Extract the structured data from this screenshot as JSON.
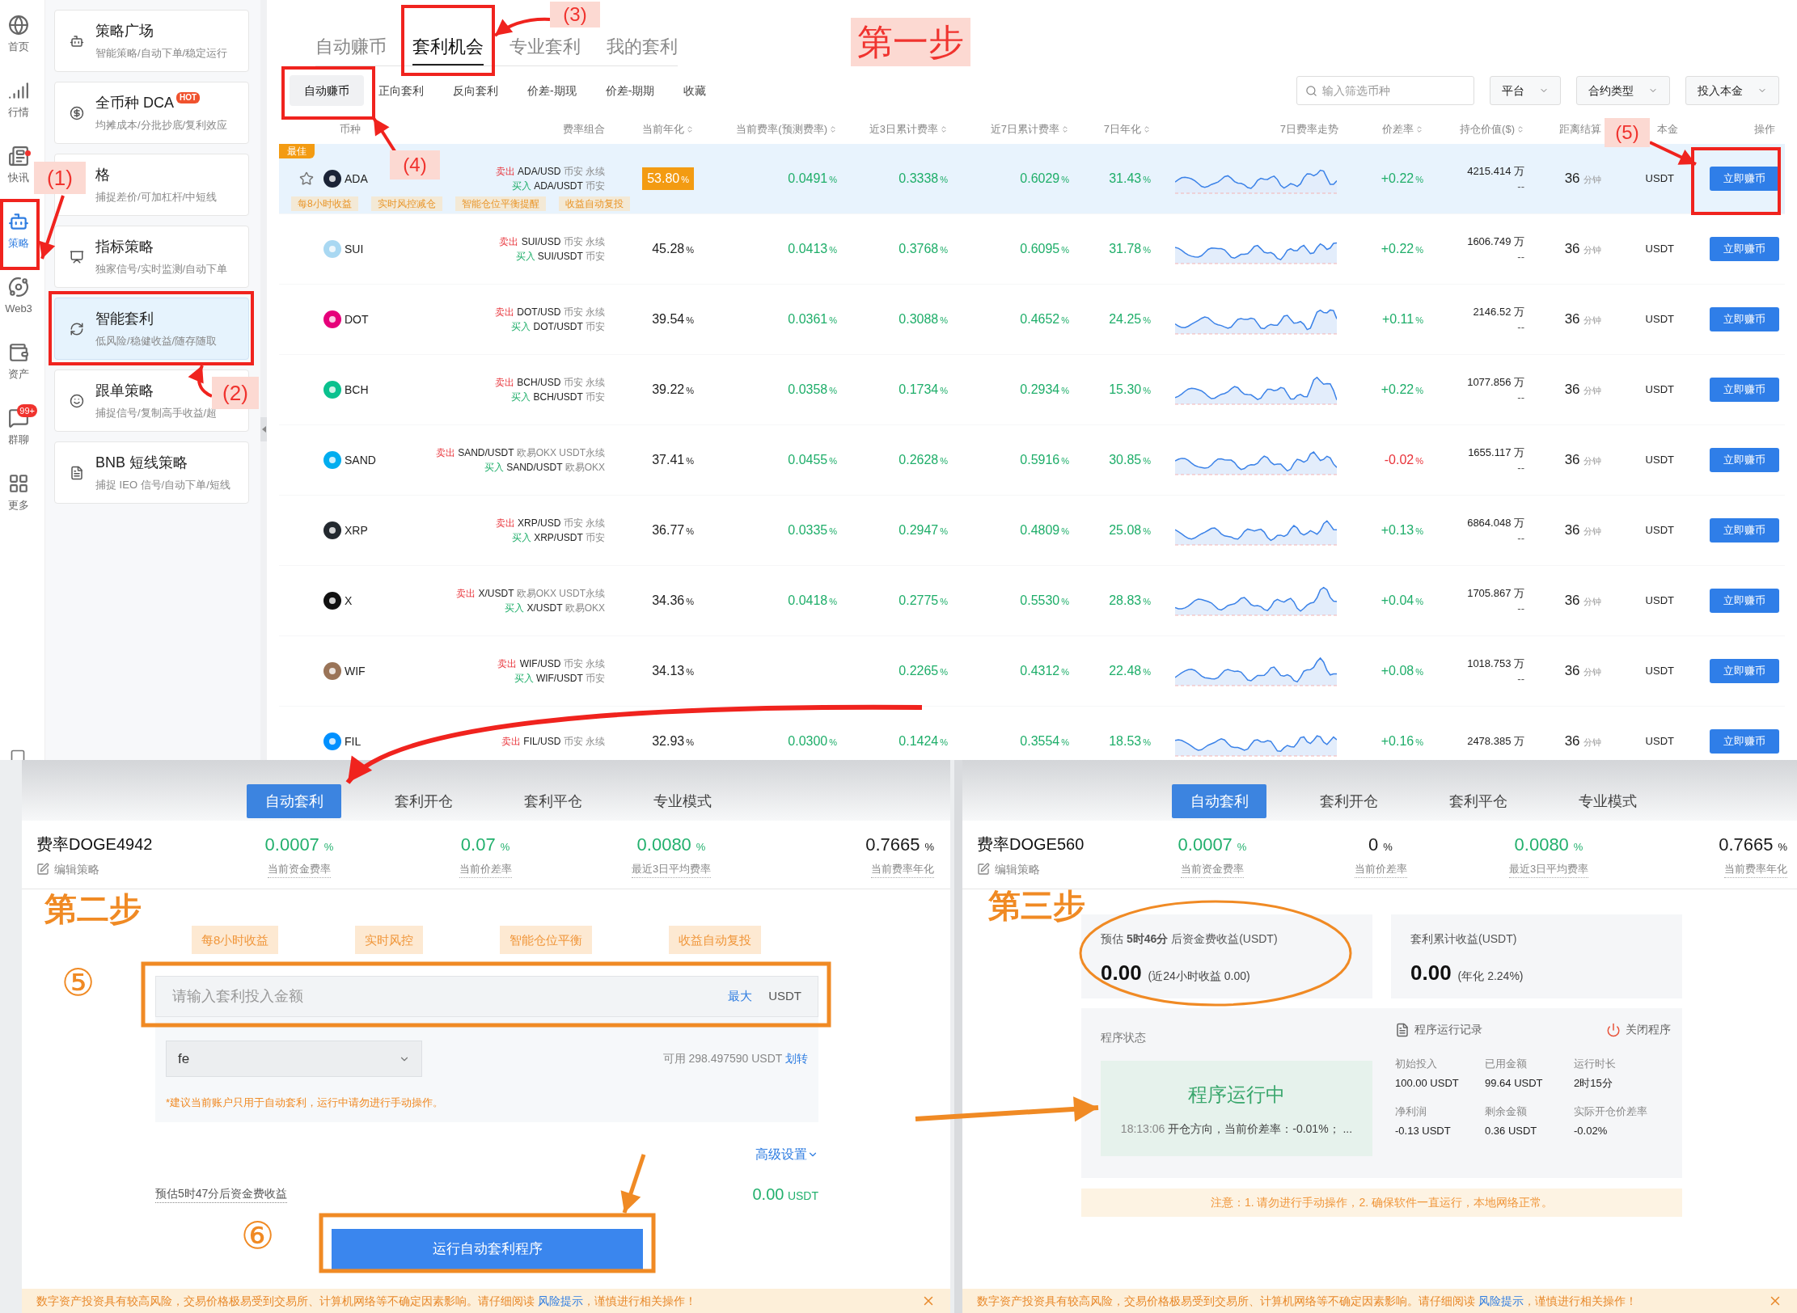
{
  "rail": [
    {
      "label": "首页",
      "selected": false,
      "dot": false
    },
    {
      "label": "行情",
      "selected": false,
      "dot": false
    },
    {
      "label": "快讯",
      "selected": false,
      "dot": true
    },
    {
      "label": "策略",
      "selected": true,
      "dot": false
    },
    {
      "label": "Web3",
      "selected": false,
      "dot": false
    },
    {
      "label": "资产",
      "selected": false,
      "dot": false
    },
    {
      "label": "群聊",
      "selected": false,
      "dot": false,
      "badge": "99+"
    },
    {
      "label": "更多",
      "selected": false,
      "dot": false
    }
  ],
  "cards": [
    {
      "title": "策略广场",
      "subtitle": "智能策略/自动下单/稳定运行",
      "selected": false
    },
    {
      "title": "全币种 DCA",
      "badge": "HOT",
      "subtitle": "均摊成本/分批抄底/复利效应",
      "selected": false
    },
    {
      "title": "格",
      "subtitle": "捕捉差价/可加杠杆/中短线",
      "selected": false
    },
    {
      "title": "指标策略",
      "subtitle": "独家信号/实时监测/自动下单",
      "selected": false
    },
    {
      "title": "智能套利",
      "subtitle": "低风险/稳健收益/随存随取",
      "selected": true
    },
    {
      "title": "跟单策略",
      "subtitle": "捕捉信号/复制高手收益/超",
      "selected": false
    },
    {
      "title": "BNB 短线策略",
      "subtitle": "捕捉 IEO 信号/自动下单/短线",
      "selected": false
    }
  ],
  "main_tabs": [
    {
      "label": "自动赚币",
      "selected": false
    },
    {
      "label": "套利机会",
      "selected": true
    },
    {
      "label": "专业套利",
      "selected": false
    },
    {
      "label": "我的套利",
      "selected": false
    }
  ],
  "sub_tabs": [
    {
      "label": "自动赚币",
      "selected": true
    },
    {
      "label": "正向套利",
      "selected": false
    },
    {
      "label": "反向套利",
      "selected": false
    },
    {
      "label": "价差-期现",
      "selected": false
    },
    {
      "label": "价差-期期",
      "selected": false
    },
    {
      "label": "收藏",
      "selected": false
    }
  ],
  "search": {
    "placeholder": "输入筛选币种"
  },
  "filters": [
    "平台",
    "合约类型",
    "投入本金"
  ],
  "table": {
    "columns": [
      {
        "label": "币种",
        "sortable": false
      },
      {
        "label": "费率组合",
        "sortable": false
      },
      {
        "label": "当前年化",
        "sortable": true
      },
      {
        "label": "当前费率(预测费率)",
        "sortable": true
      },
      {
        "label": "近3日累计费率",
        "sortable": true
      },
      {
        "label": "近7日累计费率",
        "sortable": true
      },
      {
        "label": "7日年化",
        "sortable": true
      },
      {
        "label": "7日费率走势",
        "sortable": false
      },
      {
        "label": "价差率",
        "sortable": true
      },
      {
        "label": "持仓价值($)",
        "sortable": true
      },
      {
        "label": "距离结算",
        "sortable": false
      },
      {
        "label": "本金",
        "sortable": false
      },
      {
        "label": "操作",
        "sortable": false
      }
    ],
    "rows": [
      {
        "coin": "ADA",
        "color": "#1b2336",
        "highlighted": true,
        "best": "最佳",
        "sell": {
          "action": "卖出",
          "pair": "ADA/USD",
          "venue": "币安 永续"
        },
        "buy": {
          "action": "买入",
          "pair": "ADA/USDT",
          "venue": "币安"
        },
        "annual": "53.80%",
        "rate": "0.0491%",
        "sum3": "0.3338%",
        "sum7": "0.6029%",
        "annual7": "31.43%",
        "spread": "+0.22%",
        "spread_negative": false,
        "holding": "4215.414 万",
        "holding_sub": "--",
        "settle": "36",
        "settle_unit": "分钟",
        "principal": "USDT",
        "action": "立即赚币",
        "tags": [
          "每8小时收益",
          "实时风控减仓",
          "智能仓位平衡提醒",
          "收益自动复投"
        ]
      },
      {
        "coin": "SUI",
        "color": "#a9d8f2",
        "highlighted": false,
        "sell": {
          "action": "卖出",
          "pair": "SUI/USD",
          "venue": "币安 永续"
        },
        "buy": {
          "action": "买入",
          "pair": "SUI/USDT",
          "venue": "币安"
        },
        "annual": "45.28%",
        "rate": "0.0413%",
        "sum3": "0.3768%",
        "sum7": "0.6095%",
        "annual7": "31.78%",
        "spread": "+0.22%",
        "spread_negative": false,
        "holding": "1606.749 万",
        "holding_sub": "--",
        "settle": "36",
        "settle_unit": "分钟",
        "principal": "USDT",
        "action": "立即赚币"
      },
      {
        "coin": "DOT",
        "color": "#e6007a",
        "highlighted": false,
        "sell": {
          "action": "卖出",
          "pair": "DOT/USD",
          "venue": "币安 永续"
        },
        "buy": {
          "action": "买入",
          "pair": "DOT/USDT",
          "venue": "币安"
        },
        "annual": "39.54%",
        "rate": "0.0361%",
        "sum3": "0.3088%",
        "sum7": "0.4652%",
        "annual7": "24.25%",
        "spread": "+0.11%",
        "spread_negative": false,
        "holding": "2146.52 万",
        "holding_sub": "--",
        "settle": "36",
        "settle_unit": "分钟",
        "principal": "USDT",
        "action": "立即赚币"
      },
      {
        "coin": "BCH",
        "color": "#0ac18e",
        "highlighted": false,
        "sell": {
          "action": "卖出",
          "pair": "BCH/USD",
          "venue": "币安 永续"
        },
        "buy": {
          "action": "买入",
          "pair": "BCH/USDT",
          "venue": "币安"
        },
        "annual": "39.22%",
        "rate": "0.0358%",
        "sum3": "0.1734%",
        "sum7": "0.2934%",
        "annual7": "15.30%",
        "spread": "+0.22%",
        "spread_negative": false,
        "holding": "1077.856 万",
        "holding_sub": "--",
        "settle": "36",
        "settle_unit": "分钟",
        "principal": "USDT",
        "action": "立即赚币"
      },
      {
        "coin": "SAND",
        "color": "#00adef",
        "highlighted": false,
        "sell": {
          "action": "卖出",
          "pair": "SAND/USDT",
          "venue": "欧易OKX USDT永续"
        },
        "buy": {
          "action": "买入",
          "pair": "SAND/USDT",
          "venue": "欧易OKX"
        },
        "annual": "37.41%",
        "rate": "0.0455%",
        "sum3": "0.2628%",
        "sum7": "0.5916%",
        "annual7": "30.85%",
        "spread": "-0.02%",
        "spread_negative": true,
        "holding": "1655.117 万",
        "holding_sub": "--",
        "settle": "36",
        "settle_unit": "分钟",
        "principal": "USDT",
        "action": "立即赚币"
      },
      {
        "coin": "XRP",
        "color": "#23292f",
        "highlighted": false,
        "sell": {
          "action": "卖出",
          "pair": "XRP/USD",
          "venue": "币安 永续"
        },
        "buy": {
          "action": "买入",
          "pair": "XRP/USDT",
          "venue": "币安"
        },
        "annual": "36.77%",
        "rate": "0.0335%",
        "sum3": "0.2947%",
        "sum7": "0.4809%",
        "annual7": "25.08%",
        "spread": "+0.13%",
        "spread_negative": false,
        "holding": "6864.048 万",
        "holding_sub": "--",
        "settle": "36",
        "settle_unit": "分钟",
        "principal": "USDT",
        "action": "立即赚币"
      },
      {
        "coin": "X",
        "color": "#111111",
        "highlighted": false,
        "sell": {
          "action": "卖出",
          "pair": "X/USDT",
          "venue": "欧易OKX USDT永续"
        },
        "buy": {
          "action": "买入",
          "pair": "X/USDT",
          "venue": "欧易OKX"
        },
        "annual": "34.36%",
        "rate": "0.0418%",
        "sum3": "0.2775%",
        "sum7": "0.5530%",
        "annual7": "28.83%",
        "spread": "+0.04%",
        "spread_negative": false,
        "holding": "1705.867 万",
        "holding_sub": "--",
        "settle": "36",
        "settle_unit": "分钟",
        "principal": "USDT",
        "action": "立即赚币"
      },
      {
        "coin": "WIF",
        "color": "#9a7458",
        "highlighted": false,
        "sell": {
          "action": "卖出",
          "pair": "WIF/USD",
          "venue": "币安 永续"
        },
        "buy": {
          "action": "买入",
          "pair": "WIF/USDT",
          "venue": "币安"
        },
        "annual": "34.13%",
        "sum3": "0.2265%",
        "sum7": "0.4312%",
        "annual7": "22.48%",
        "spread": "+0.08%",
        "spread_negative": false,
        "holding": "1018.753 万",
        "holding_sub": "--",
        "settle": "36",
        "settle_unit": "分钟",
        "principal": "USDT",
        "action": "立即赚币"
      },
      {
        "coin": "FIL",
        "color": "#0090ff",
        "highlighted": false,
        "sell": {
          "action": "卖出",
          "pair": "FIL/USD",
          "venue": "币安 永续"
        },
        "annual": "32.93%",
        "rate": "0.0300%",
        "sum3": "0.1424%",
        "sum7": "0.3554%",
        "annual7": "18.53%",
        "spread": "+0.16%",
        "spread_negative": false,
        "holding": "2478.385 万",
        "settle": "36",
        "settle_unit": "分钟",
        "principal": "USDT",
        "action": "立即赚币"
      }
    ]
  },
  "panels": [
    {
      "kind": "setup",
      "tabs": [
        {
          "label": "自动套利",
          "selected": true
        },
        {
          "label": "套利开仓",
          "selected": false
        },
        {
          "label": "套利平仓",
          "selected": false
        },
        {
          "label": "专业模式",
          "selected": false
        }
      ],
      "title": "费率DOGE4942",
      "edit": "编辑策略",
      "metrics": [
        {
          "value": "0.0007",
          "unit": "%",
          "label": "当前资金费率",
          "color": "#22b06d"
        },
        {
          "value": "0.07",
          "unit": "%",
          "label": "当前价差率",
          "color": "#22b06d"
        },
        {
          "value": "0.0080",
          "unit": "%",
          "label": "最近3日平均费率",
          "color": "#22b06d"
        },
        {
          "value": "0.7665",
          "unit": "%",
          "label": "当前费率年化",
          "color": "#1a1a1a"
        }
      ],
      "tags": [
        "每8小时收益",
        "实时风控",
        "智能仓位平衡",
        "收益自动复投"
      ],
      "amount_input": {
        "placeholder": "请输入套利投入金额",
        "max": "最大",
        "unit": "USDT"
      },
      "account_select": {
        "value": "fe"
      },
      "available": {
        "text": "可用 298.497590 USDT",
        "link": "划转"
      },
      "note": "*建议当前账户只用于自动套利，运行中请勿进行手动操作。",
      "advanced": "高级设置",
      "estimate": {
        "label": "预估5时47分后资金费收益",
        "value": "0.00",
        "unit": "USDT"
      },
      "run_button": "运行自动套利程序",
      "footer": {
        "before": "数字资产投资具有较高风险，交易价格极易受到交易所、计算机网络等不确定因素影响。请仔细阅读 ",
        "link": "风险提示",
        "after": "，谨慎进行相关操作！"
      }
    },
    {
      "kind": "running",
      "tabs": [
        {
          "label": "自动套利",
          "selected": true
        },
        {
          "label": "套利开仓",
          "selected": false
        },
        {
          "label": "套利平仓",
          "selected": false
        },
        {
          "label": "专业模式",
          "selected": false
        }
      ],
      "title": "费率DOGE560",
      "edit": "编辑策略",
      "metrics": [
        {
          "value": "0.0007",
          "unit": "%",
          "label": "当前资金费率",
          "color": "#22b06d"
        },
        {
          "value": "0",
          "unit": "%",
          "label": "当前价差率",
          "color": "#1a1a1a"
        },
        {
          "value": "0.0080",
          "unit": "%",
          "label": "最近3日平均费率",
          "color": "#22b06d"
        },
        {
          "value": "0.7665",
          "unit": "%",
          "label": "当前费率年化",
          "color": "#1a1a1a"
        }
      ],
      "estimate_card": {
        "label": "预估 **5时46分** 后资金费收益(USDT)",
        "value": "0.00",
        "note": "(近24小时收益 0.00)"
      },
      "total_card": {
        "label": "套利累计收益(USDT)",
        "value": "0.00",
        "note": "(年化 2.24%)"
      },
      "status": {
        "label": "程序状态",
        "state": "程序运行中",
        "time": "18:13:06",
        "message": "开仓方向，当前价差率：-0.01%；  ..."
      },
      "log_link": "程序运行记录",
      "stop": "关闭程序",
      "stats": [
        {
          "label": "初始投入",
          "value": "100.00 USDT"
        },
        {
          "label": "已用金额",
          "value": "99.64 USDT"
        },
        {
          "label": "运行时长",
          "value": "2时15分"
        },
        {
          "label": "净利润",
          "value": "-0.13 USDT"
        },
        {
          "label": "剩余金额",
          "value": "0.36 USDT"
        },
        {
          "label": "实际开仓价差率",
          "value": "-0.02%"
        }
      ],
      "notice": "注意：1. 请勿进行手动操作，2. 确保软件一直运行，本地网络正常。",
      "footer": {
        "before": "数字资产投资具有较高风险，交易价格极易受到交易所、计算机网络等不确定因素影响。请仔细阅读 ",
        "link": "风险提示",
        "after": "，谨慎进行相关操作！"
      }
    }
  ],
  "annotations": [
    {
      "kind": "callout",
      "text": "(1)"
    },
    {
      "kind": "callout",
      "text": "(2)"
    },
    {
      "kind": "callout",
      "text": "(3)"
    },
    {
      "kind": "callout",
      "text": "(4)"
    },
    {
      "kind": "callout",
      "text": "(5)"
    },
    {
      "kind": "step_callout",
      "text": "第一步"
    },
    {
      "kind": "step",
      "text": "第二步"
    },
    {
      "kind": "number",
      "text": "⑤"
    },
    {
      "kind": "number",
      "text": "⑥"
    },
    {
      "kind": "step",
      "text": "第三步"
    }
  ]
}
